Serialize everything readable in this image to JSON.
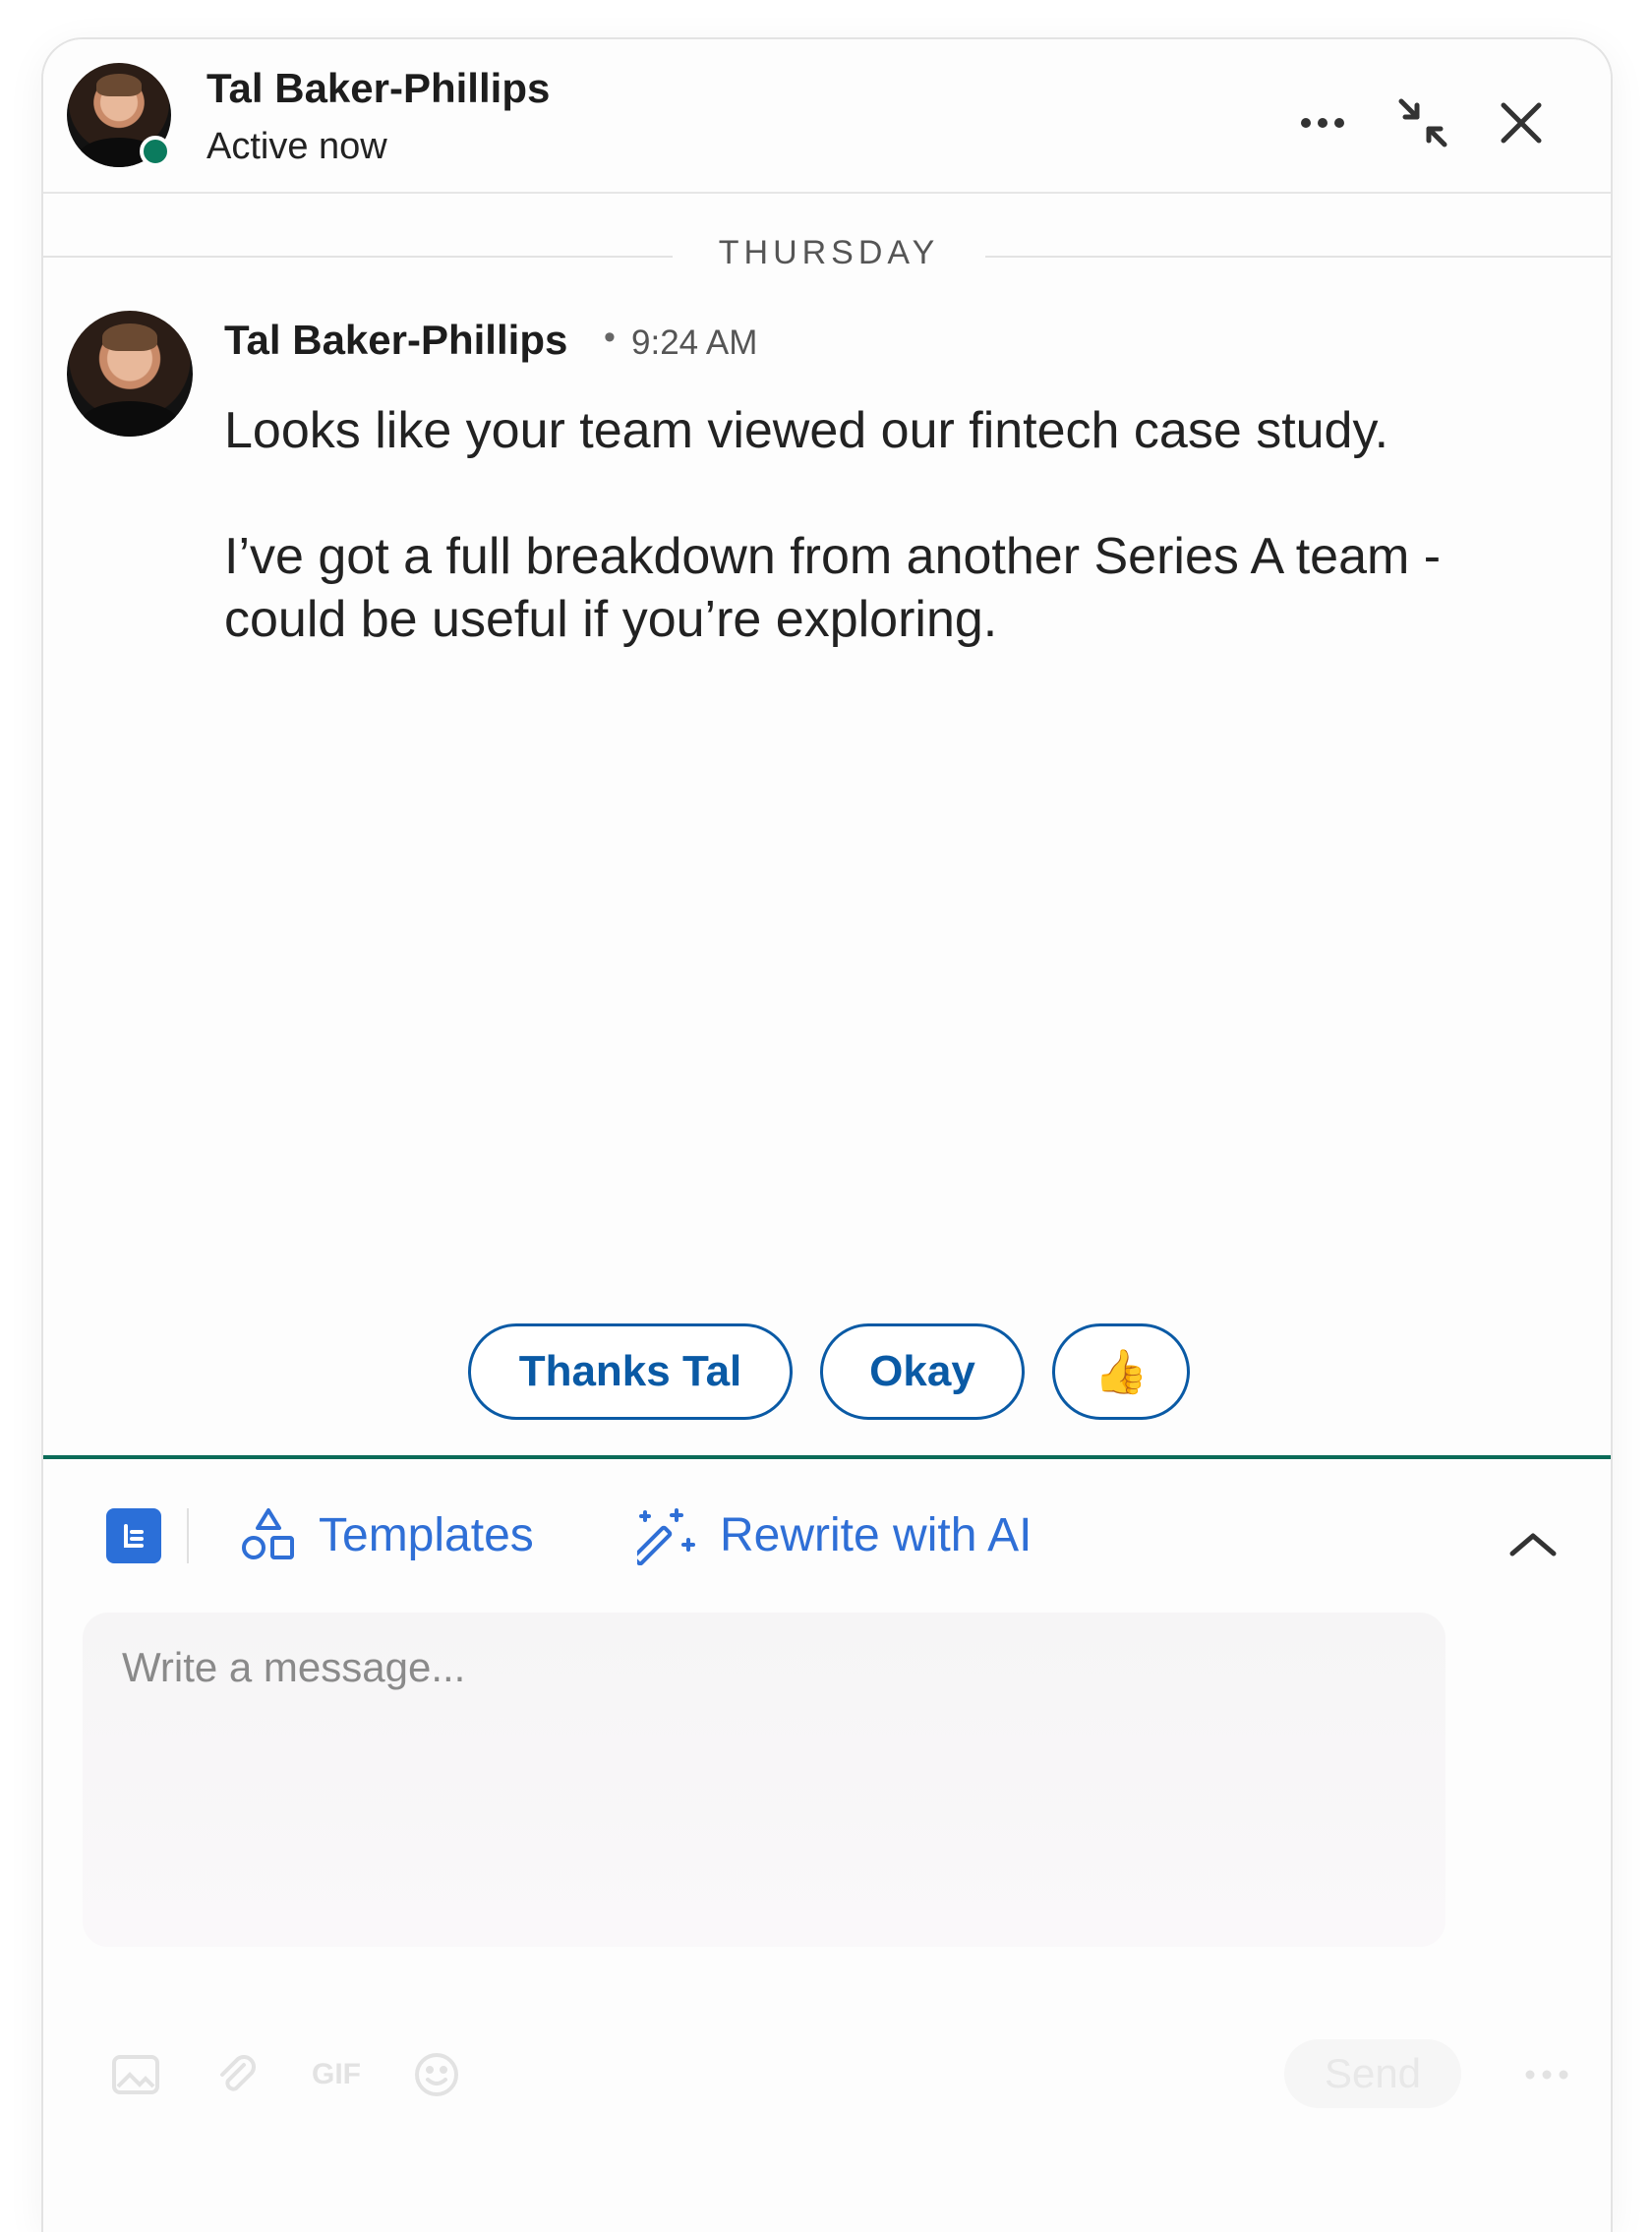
{
  "header": {
    "name": "Tal Baker-Phillips",
    "status": "Active now",
    "icons": [
      "more-icon",
      "minimize-icon",
      "close-icon"
    ]
  },
  "conversation": {
    "date_label": "THURSDAY",
    "message": {
      "sender": "Tal Baker-Phillips",
      "separator": "•",
      "time": "9:24 AM",
      "paragraphs": [
        "Looks like your team viewed our fintech case study.",
        "I’ve got a full breakdown from another Series A team - could be useful if you’re exploring."
      ]
    }
  },
  "quick_replies": [
    "Thanks Tal",
    "Okay",
    "👍"
  ],
  "composer": {
    "templates_label": "Templates",
    "rewrite_label": "Rewrite with AI",
    "placeholder": "Write a message...",
    "gif_label": "GIF",
    "send_label": "Send"
  },
  "colors": {
    "accent_blue": "#0a5aa5",
    "link_blue": "#2f6fd6",
    "presence_green": "#0b7b5e",
    "composer_border": "#0b6b58"
  }
}
